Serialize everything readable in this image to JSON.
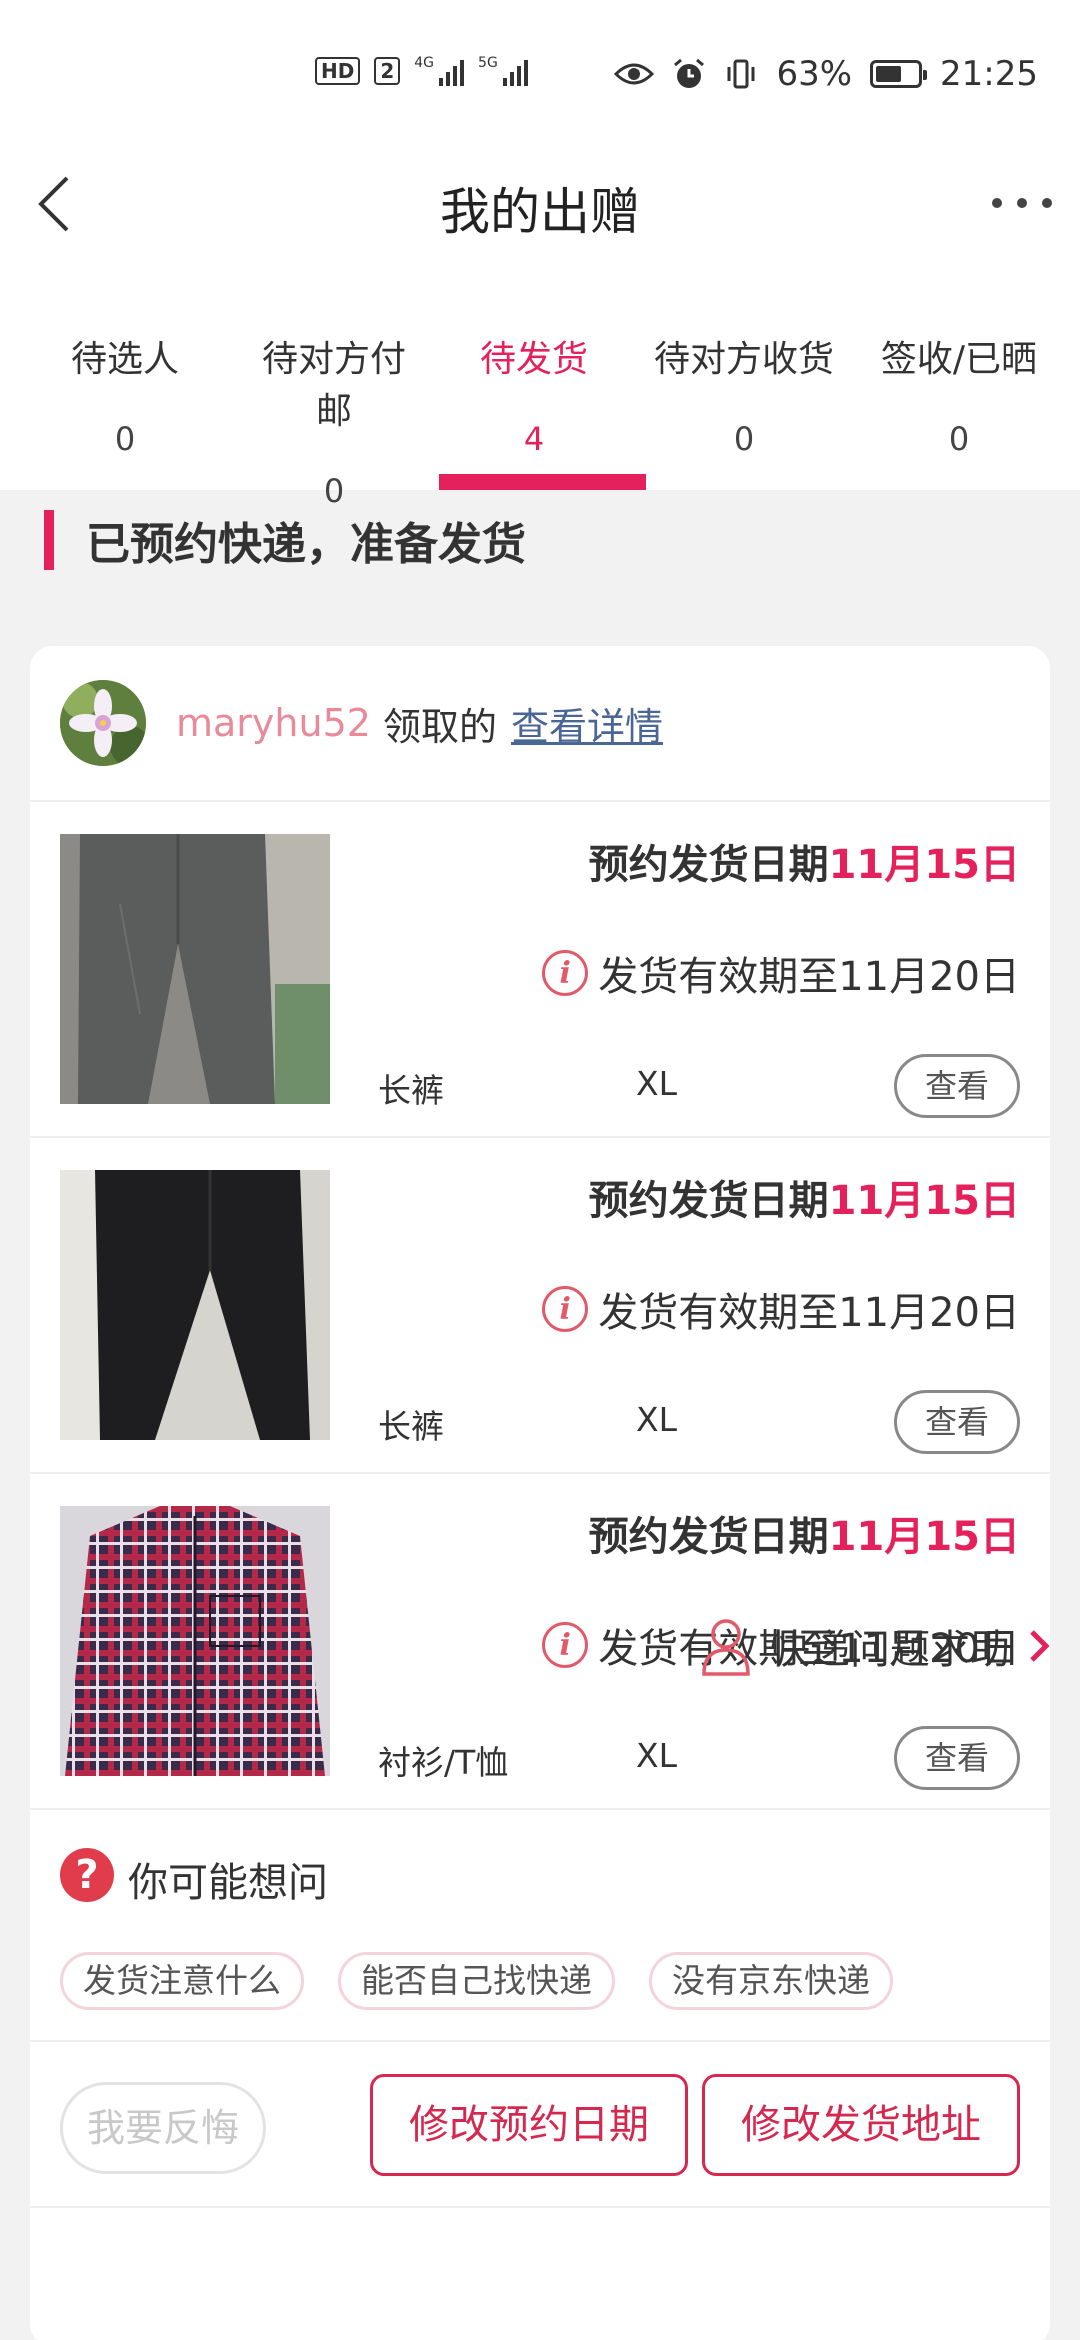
{
  "status_bar": {
    "hd": "HD",
    "sim_badge": "2",
    "net1": "4G",
    "net2": "5G",
    "battery": "63%",
    "battery_level": 0.63,
    "time": "21:25"
  },
  "header": {
    "title": "我的出赠"
  },
  "tabs": [
    {
      "label": "待选人",
      "count": "0",
      "active": false
    },
    {
      "label": "待对方付邮",
      "count": "0",
      "active": false
    },
    {
      "label": "待发货",
      "count": "4",
      "active": true
    },
    {
      "label": "待对方收货",
      "count": "0",
      "active": false
    },
    {
      "label": "签收/已晒",
      "count": "0",
      "active": false
    }
  ],
  "section": {
    "title": "已预约快递，准备发货"
  },
  "order": {
    "username": "maryhu52",
    "taken_label": "领取的",
    "detail_link": "查看详情",
    "items": [
      {
        "date_label": "预约发货日期",
        "date_value": "11月15日",
        "valid_text": "发货有效期至11月20日",
        "category": "长裤",
        "size": "XL",
        "view_label": "查看"
      },
      {
        "date_label": "预约发货日期",
        "date_value": "11月15日",
        "valid_text": "发货有效期至11月20日",
        "category": "长裤",
        "size": "XL",
        "view_label": "查看"
      },
      {
        "date_label": "预约发货日期",
        "date_value": "11月15日",
        "valid_text": "发货有效期至11月20日",
        "category": "衬衫/T恤",
        "size": "XL",
        "view_label": "查看"
      }
    ]
  },
  "faq": {
    "title": "你可能想问",
    "chips": [
      "发货注意什么",
      "能否自己找快递",
      "没有京东快递"
    ]
  },
  "actions": {
    "regret": "我要反悔",
    "change_date": "修改预约日期",
    "change_address": "修改发货地址"
  },
  "help": {
    "label": "快递问题求助"
  },
  "colors": {
    "accent": "#e5215b",
    "link": "#4a6694",
    "username": "#e88a9a"
  }
}
